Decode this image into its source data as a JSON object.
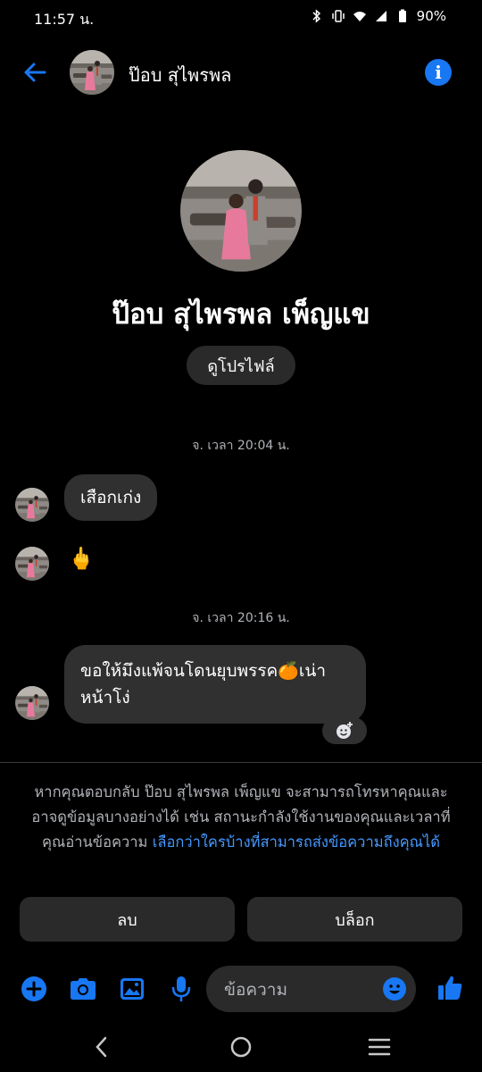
{
  "status_bar": {
    "time": "11:57 น.",
    "battery": "90%"
  },
  "header": {
    "name": "ป๊อบ สุไพรพล"
  },
  "profile": {
    "name": "ป๊อบ สุไพรพล เพ็ญแข",
    "view_profile_label": "ดูโปรไฟล์"
  },
  "messages": {
    "timestamp_1": "จ. เวลา 20:04 น.",
    "msg_1": "เสือกเก่ง",
    "msg_2_emoji": "🖕",
    "timestamp_2": "จ. เวลา 20:16 น.",
    "msg_3_line_1": "ขอให้มึงแพ้จนโดนยุบพรรค🍊เน่า",
    "msg_3_line_2": "หน้าโง่"
  },
  "notice": {
    "text": "หากคุณตอบกลับ ป๊อบ สุไพรพล เพ็ญแข จะสามารถโทรหาคุณและอาจดูข้อมูลบางอย่างได้ เช่น สถานะกำลังใช้งานของคุณและเวลาที่คุณอ่านข้อความ ",
    "link": "เลือกว่าใครบ้างที่สามารถส่งข้อความถึงคุณได้"
  },
  "actions": {
    "delete_label": "ลบ",
    "block_label": "บล็อก"
  },
  "composer": {
    "placeholder": "ข้อความ"
  },
  "colors": {
    "accent": "#1877f2",
    "link": "#4599ff",
    "bubble": "#303030"
  },
  "icons": {
    "status": [
      "bluetooth-icon",
      "vibrate-icon",
      "wifi-icon",
      "signal-icon",
      "battery-icon"
    ],
    "header": [
      "back-arrow-icon",
      "info-icon"
    ],
    "composer": [
      "plus-icon",
      "camera-icon",
      "gallery-icon",
      "mic-icon",
      "emoji-icon",
      "thumbs-up-icon"
    ],
    "nav": [
      "nav-back-icon",
      "nav-home-icon",
      "nav-recent-icon"
    ]
  }
}
